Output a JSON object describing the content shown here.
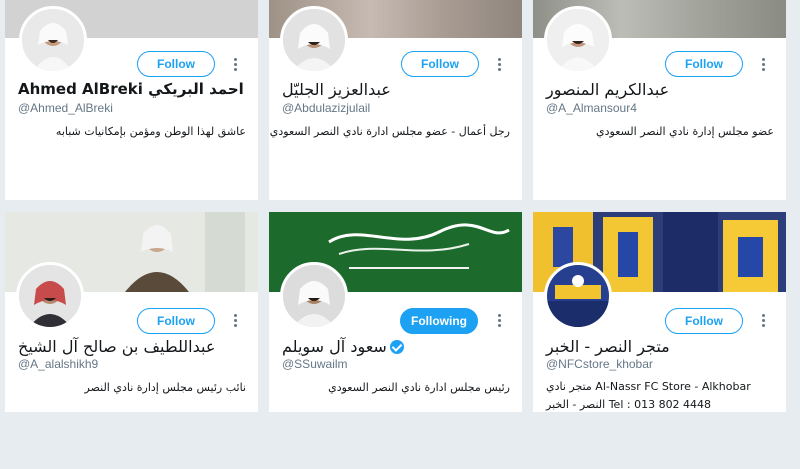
{
  "accounts": [
    {
      "name": "Ahmed AlBreki احمد البريكي",
      "handle": "@Ahmed_AlBreki",
      "bio": "عاشق لهذا الوطن ومؤمن بإمكانيات شبابه",
      "button": "Follow",
      "banner_color": "#c9c9c9"
    },
    {
      "name": "عبدالعزيز الجليّل",
      "handle": "@Abdulazizjulail",
      "bio": "رجل أعمال - عضو مجلس ادارة نادي النصر السعودي",
      "button": "Follow",
      "banner_color": "#b8aca4"
    },
    {
      "name": "عبدالكريم المنصور",
      "handle": "@A_Almansour4",
      "bio": "عضو مجلس إدارة نادي النصر السعودي",
      "button": "Follow",
      "banner_color": "#a9aba4"
    },
    {
      "name": "عبداللطيف بن صالح آل الشيخ",
      "handle": "@A_alalshikh9",
      "bio": "نائب رئيس مجلس إدارة نادي النصر",
      "button": "Follow",
      "banner_color": "#e4e6e3"
    },
    {
      "name": "سعود آل سويلم",
      "handle": "@SSuwailm",
      "bio": "رئيس مجلس ادارة نادي النصر السعودي",
      "button": "Following",
      "verified": true,
      "banner_color": "#1f6b2e"
    },
    {
      "name": "متجر النصر - الخبر",
      "handle": "@NFCstore_khobar",
      "bio": "متجر نادي Al-Nassr FC Store - Alkhobar",
      "bio_line2": "النصر - الخبر Tel : 013 802 4448",
      "button": "Follow",
      "banner_color": "#f2c230"
    }
  ]
}
